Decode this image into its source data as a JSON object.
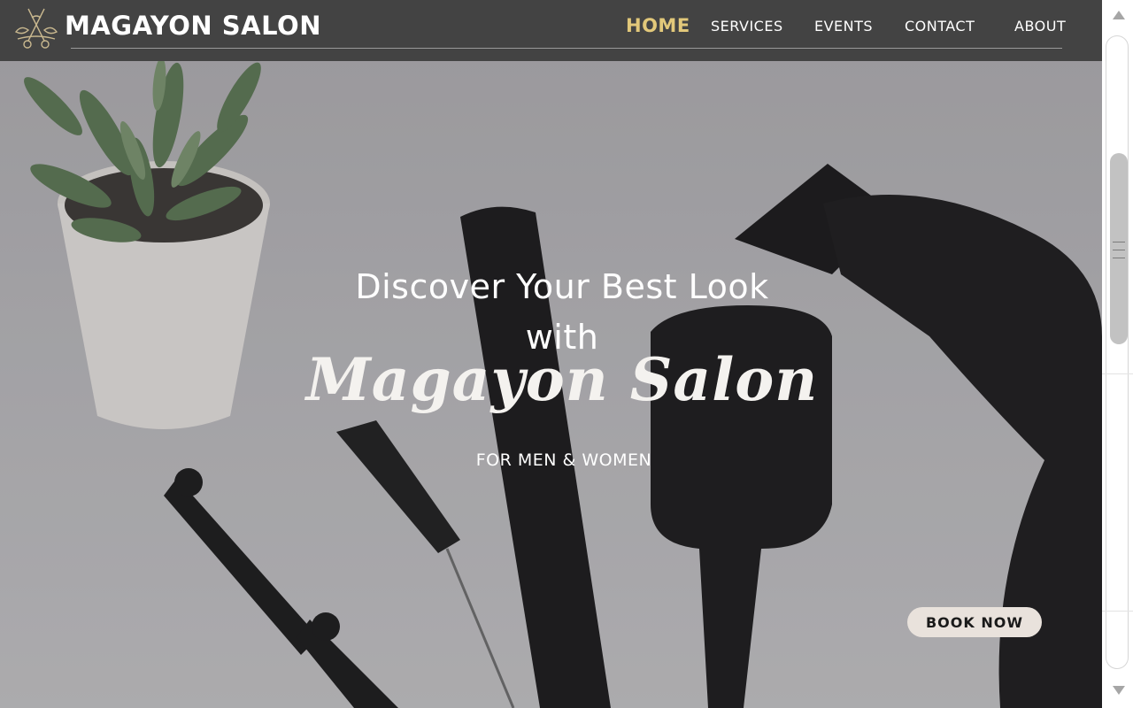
{
  "header": {
    "brand": "MAGAYON SALON",
    "logo_icon": "scissors-ornament-icon"
  },
  "nav": {
    "items": [
      {
        "label": "HOME",
        "active": true
      },
      {
        "label": "SERVICES",
        "active": false
      },
      {
        "label": "EVENTS",
        "active": false
      },
      {
        "label": "CONTACT",
        "active": false
      },
      {
        "label": "ABOUT",
        "active": false
      }
    ]
  },
  "hero": {
    "headline_line1": "Discover Your Best Look",
    "headline_line2": "with",
    "brand_name": "Magayon Salon",
    "tagline": "FOR MEN & WOMEN",
    "cta_label": "BOOK NOW"
  },
  "colors": {
    "header_bg": "#434343",
    "active_nav": "#e2c87a",
    "cta_bg": "#e9e2dc"
  }
}
